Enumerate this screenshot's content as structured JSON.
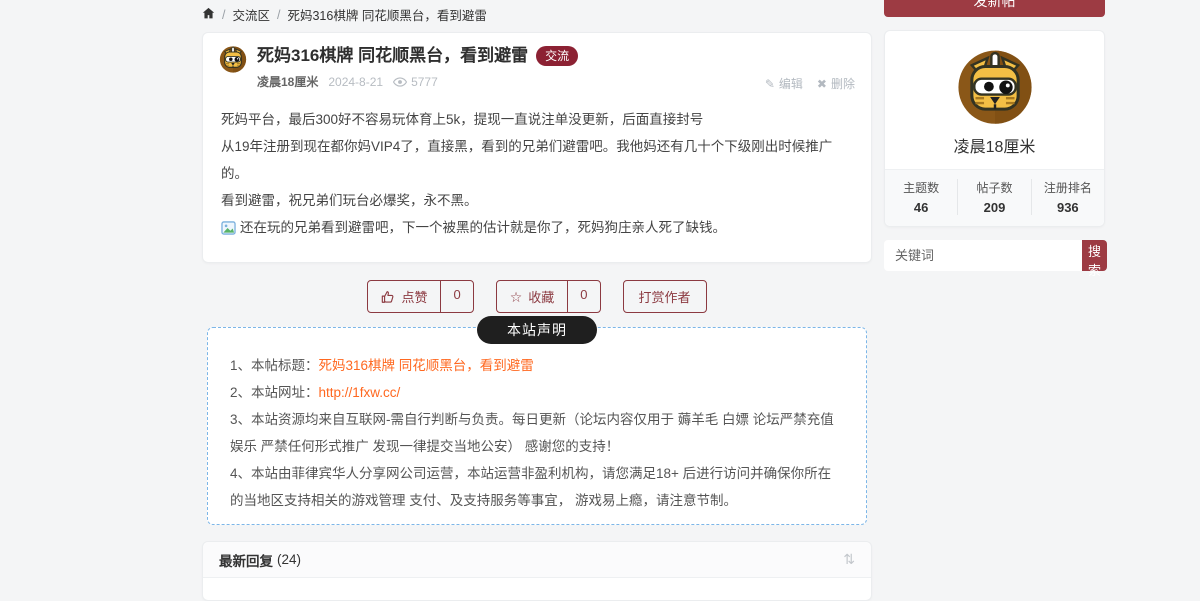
{
  "colors": {
    "accent": "#9d3b43",
    "badge": "#8c2133",
    "link": "#ff6820",
    "dash": "#7cb6e8",
    "pill": "#1f1f1f"
  },
  "breadcrumb": {
    "sep": "/",
    "items": [
      "交流区",
      "死妈316棋牌 同花顺黑台，看到避雷"
    ]
  },
  "post": {
    "title": "死妈316棋牌 同花顺黑台，看到避雷",
    "badge": "交流",
    "author": "凌晨18厘米",
    "date": "2024-8-21",
    "views": "5777",
    "edit_label": "编辑",
    "delete_label": "删除",
    "paragraphs": [
      "死妈平台，最后300好不容易玩体育上5k，提现一直说注单没更新，后面直接封号",
      "从19年注册到现在都你妈VIP4了，直接黑，看到的兄弟们避雷吧。我他妈还有几十个下级刚出时候推广的。",
      "看到避雷，祝兄弟们玩台必爆奖，永不黑。",
      "还在玩的兄弟看到避雷吧，下一个被黑的估计就是你了，死妈狗庄亲人死了缺钱。"
    ]
  },
  "actions": {
    "like": {
      "label": "点赞",
      "count": "0"
    },
    "fav": {
      "label": "收藏",
      "count": "0"
    },
    "reward": {
      "label": "打赏作者"
    }
  },
  "statement": {
    "badge": "本站声明",
    "items": [
      {
        "prefix": "1、本帖标题：",
        "link": "死妈316棋牌 同花顺黑台，看到避雷"
      },
      {
        "prefix": "2、本站网址：",
        "link": "http://1fxw.cc/"
      },
      {
        "prefix": "3、本站资源均来自互联网-需自行判断与负责。每日更新（论坛内容仅用于 薅羊毛 白嫖 论坛严禁充值娱乐 严禁任何形式推广 发现一律提交当地公安） 感谢您的支持！",
        "link": ""
      },
      {
        "prefix": "4、本站由菲律宾华人分享网公司运营，本站运营非盈利机构，请您满足18+ 后进行访问并确保你所在的当地区支持相关的游戏管理 支付、及支持服务等事宜， 游戏易上瘾，请注意节制。",
        "link": ""
      }
    ]
  },
  "replies": {
    "title": "最新回复",
    "count": "(24)"
  },
  "sidebar": {
    "new_post_label": "发新帖",
    "username": "凌晨18厘米",
    "stats": [
      {
        "label": "主题数",
        "value": "46"
      },
      {
        "label": "帖子数",
        "value": "209"
      },
      {
        "label": "注册排名",
        "value": "936"
      }
    ],
    "search_placeholder": "关键词",
    "search_button": "搜索"
  }
}
